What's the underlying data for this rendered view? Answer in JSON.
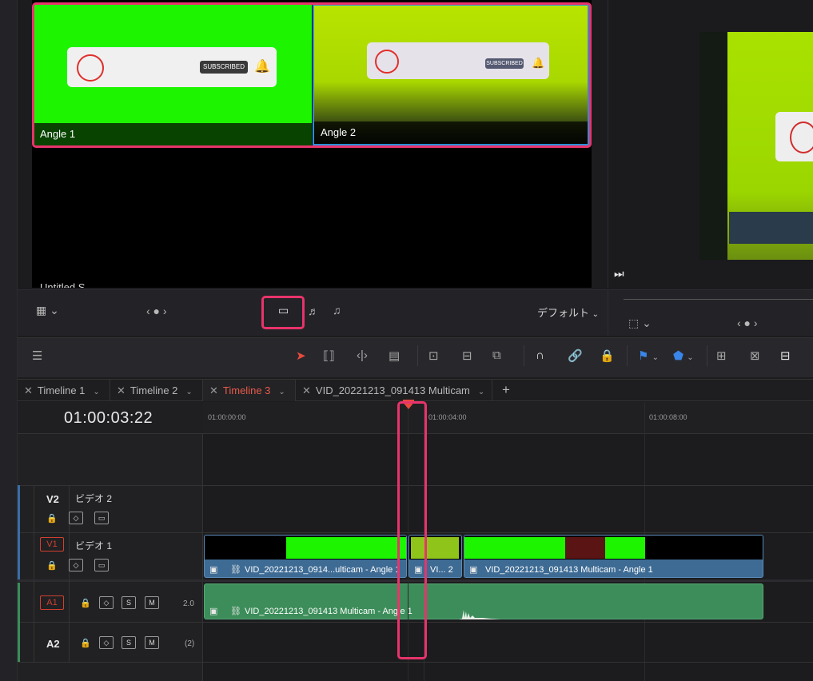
{
  "viewer": {
    "angles": [
      {
        "label": "Angle 1"
      },
      {
        "label": "Angle 2"
      }
    ],
    "subscribe_text": "SUBSCRIBED",
    "bottom_label": "Untitled S"
  },
  "controls": {
    "audio_preset": "デフォルト"
  },
  "tabs": [
    {
      "label": "Timeline 1"
    },
    {
      "label": "Timeline 2"
    },
    {
      "label": "Timeline 3"
    },
    {
      "label": "VID_20221213_091413 Multicam"
    }
  ],
  "timecode": "01:00:03:22",
  "ruler": [
    "01:00:00:00",
    "01:00:04:00",
    "01:00:08:00"
  ],
  "tracks": {
    "v2": {
      "id": "V2",
      "name": "ビデオ 2"
    },
    "v1": {
      "id": "V1",
      "name": "ビデオ 1"
    },
    "a1": {
      "id": "A1",
      "level": "2.0"
    },
    "a2": {
      "id": "A2",
      "level": "(2)"
    }
  },
  "track_buttons": {
    "solo": "S",
    "mute": "M"
  },
  "clips": {
    "v1_a": "VID_20221213_0914...ulticam - Angle 1",
    "v1_b": "VI... 2",
    "v1_c": "VID_20221213_091413 Multicam - Angle 1",
    "a1": "VID_20221213_091413 Multicam - Angle 1"
  },
  "colors": {
    "accent_red": "#e85a4a",
    "highlight": "#e8336b",
    "video_clip": "#3d6b94",
    "audio_clip": "#3c8d5a"
  }
}
